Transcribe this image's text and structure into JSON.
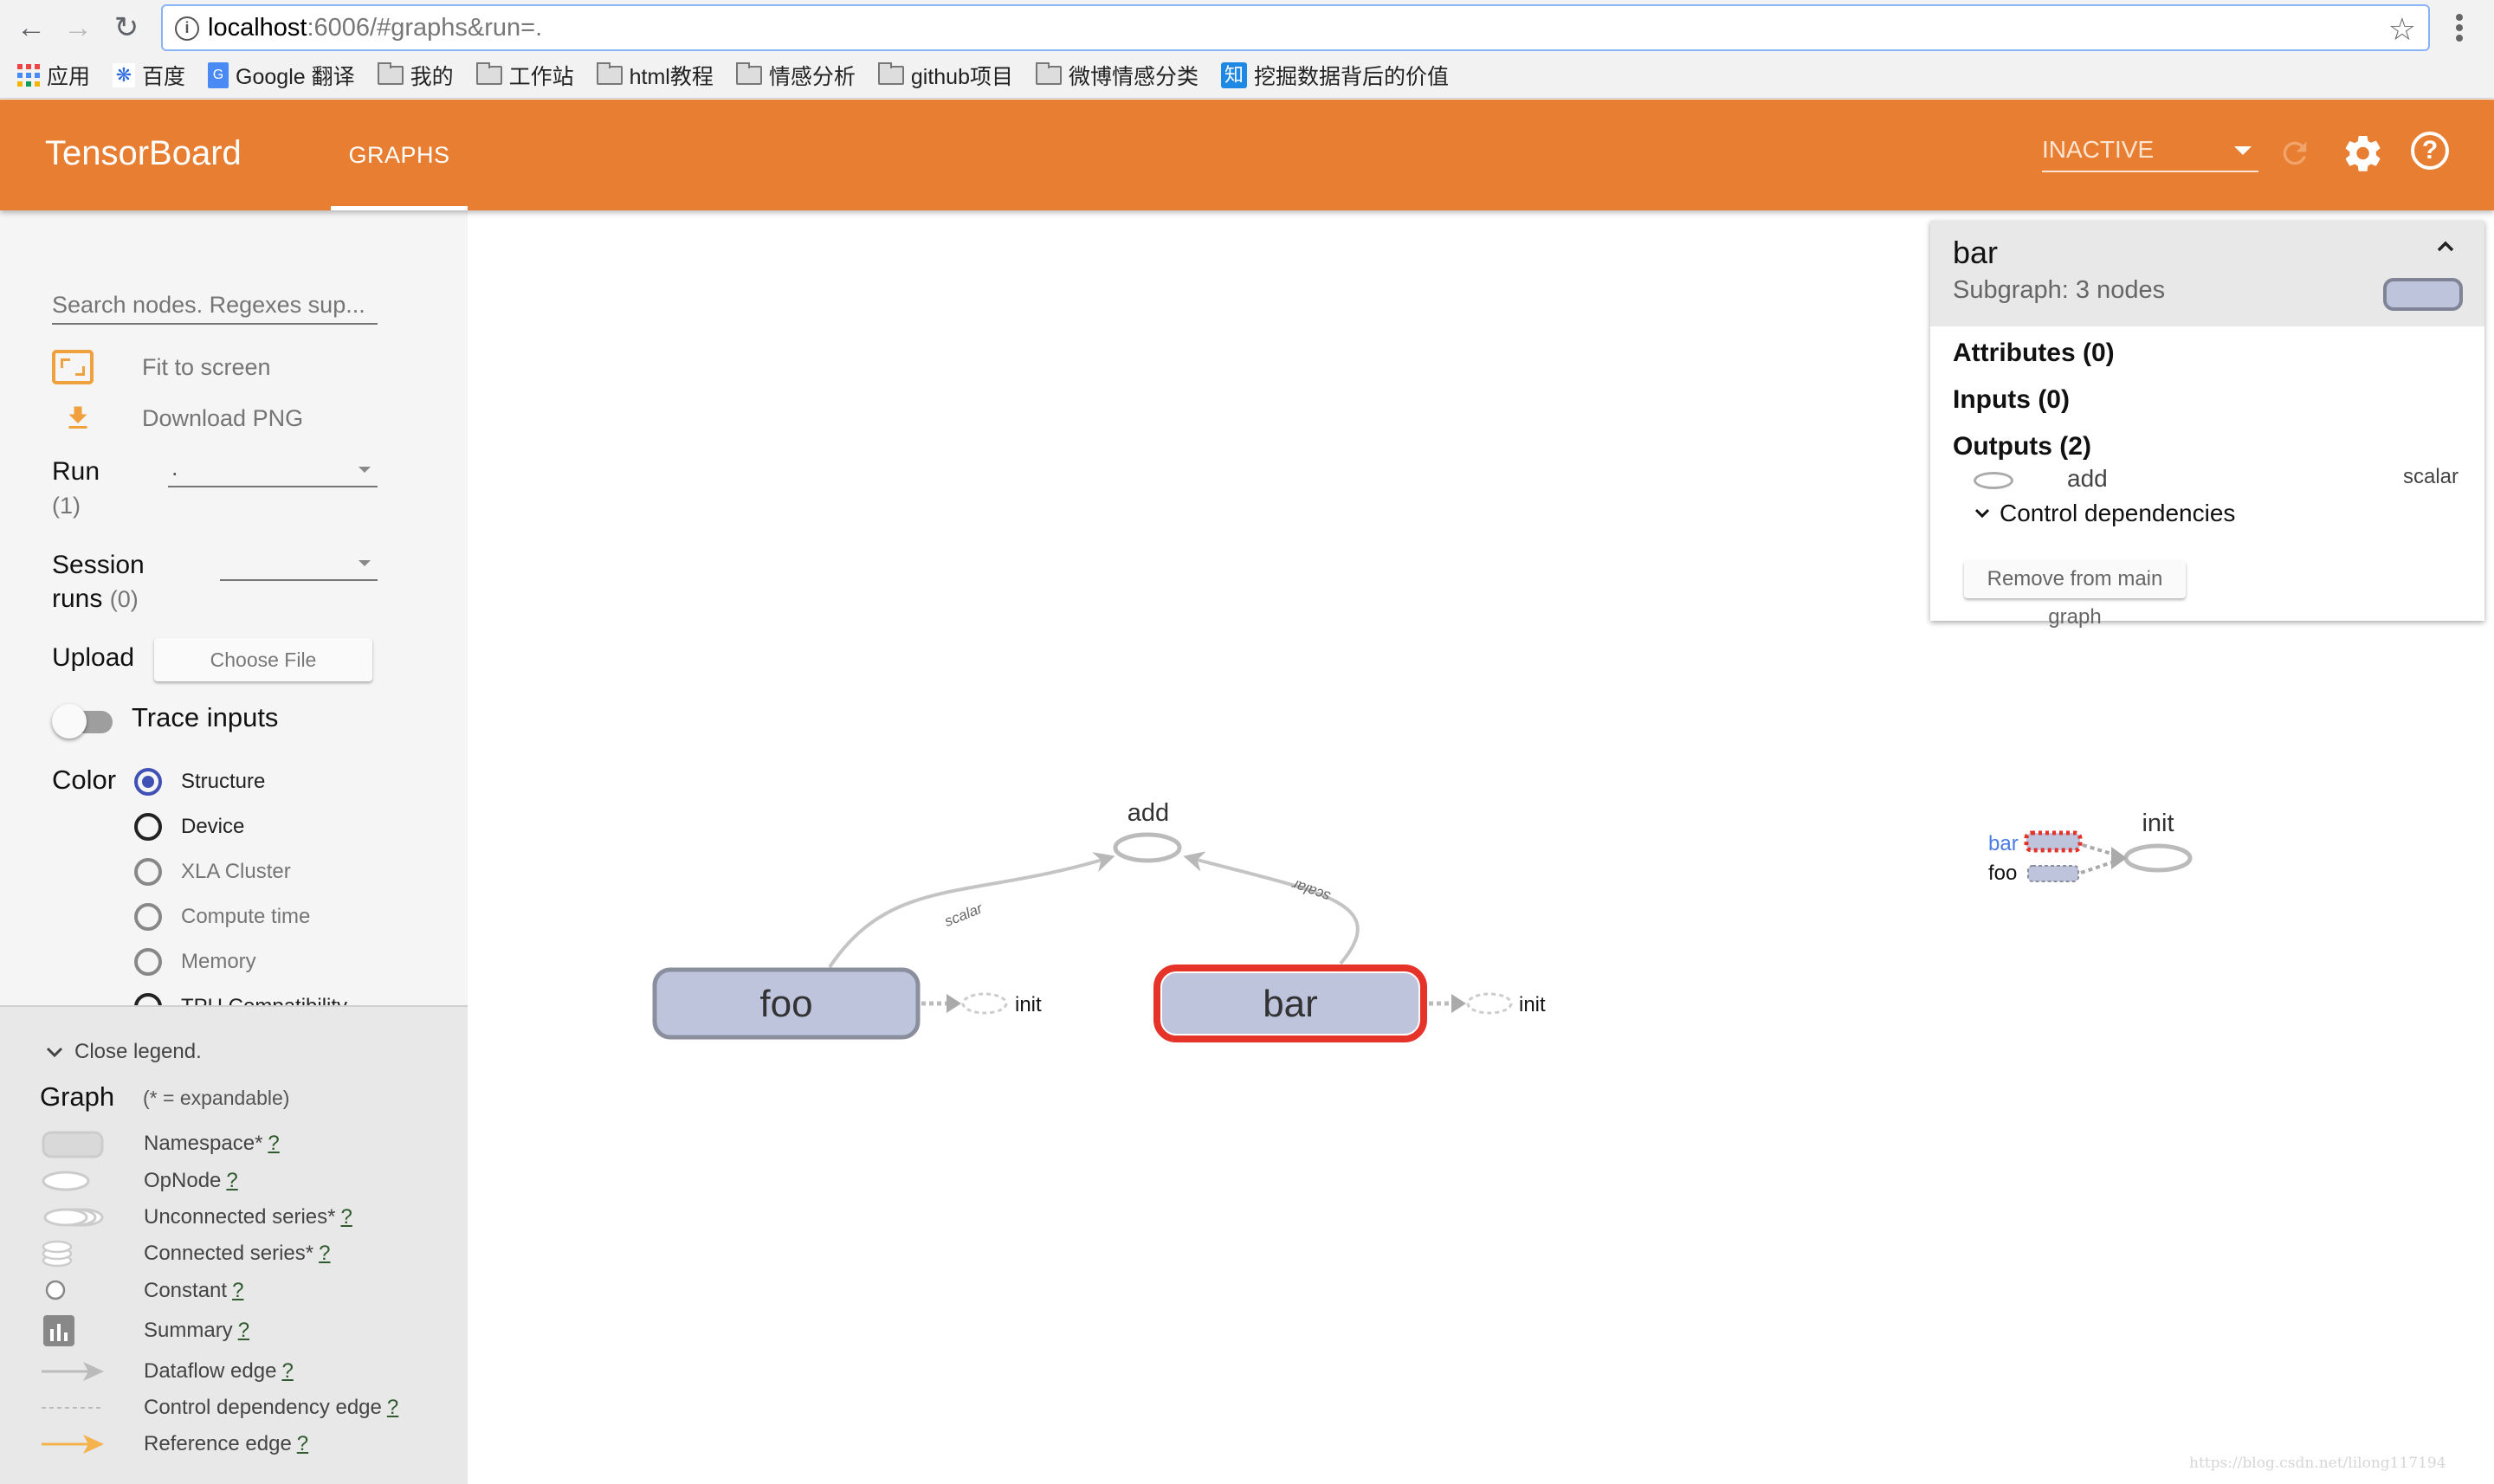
{
  "browser": {
    "url_host": "localhost",
    "url_rest": ":6006/#graphs&run=.",
    "bookmarks": [
      {
        "label": "应用",
        "icon": "apps-grid-icon"
      },
      {
        "label": "百度",
        "icon": "baidu-icon"
      },
      {
        "label": "Google 翻译",
        "icon": "google-translate-icon"
      },
      {
        "label": "我的",
        "icon": "folder-icon"
      },
      {
        "label": "工作站",
        "icon": "folder-icon"
      },
      {
        "label": "html教程",
        "icon": "folder-icon"
      },
      {
        "label": "情感分析",
        "icon": "folder-icon"
      },
      {
        "label": "github项目",
        "icon": "folder-icon"
      },
      {
        "label": "微博情感分类",
        "icon": "folder-icon"
      },
      {
        "label": "挖掘数据背后的价值",
        "icon": "zhihu-icon"
      }
    ]
  },
  "header": {
    "brand": "TensorBoard",
    "tab": "GRAPHS",
    "run_select": "INACTIVE",
    "accent_color": "#e87e31"
  },
  "sidebar": {
    "search_placeholder": "Search nodes. Regexes sup...",
    "fit_label": "Fit to screen",
    "download_label": "Download PNG",
    "run_label": "Run",
    "run_count": "(1)",
    "run_value": ".",
    "session_label_1": "Session",
    "session_label_2": "runs",
    "session_count": "(0)",
    "session_value": "",
    "upload_label": "Upload",
    "choose_file": "Choose File",
    "trace_inputs": "Trace inputs",
    "trace_inputs_on": false,
    "color_label": "Color",
    "color_options": [
      {
        "label": "Structure",
        "selected": true
      },
      {
        "label": "Device",
        "selected": false
      },
      {
        "label": "XLA Cluster",
        "selected": false
      },
      {
        "label": "Compute time",
        "selected": false
      },
      {
        "label": "Memory",
        "selected": false
      },
      {
        "label": "TPU Compatibility",
        "selected": false
      }
    ]
  },
  "legend": {
    "close": "Close legend.",
    "title": "Graph",
    "subtitle": "(* = expandable)",
    "help": "?",
    "items": [
      {
        "label": "Namespace*"
      },
      {
        "label": "OpNode"
      },
      {
        "label": "Unconnected series*"
      },
      {
        "label": "Connected series*"
      },
      {
        "label": "Constant"
      },
      {
        "label": "Summary"
      },
      {
        "label": "Dataflow edge"
      },
      {
        "label": "Control dependency edge"
      },
      {
        "label": "Reference edge"
      }
    ]
  },
  "graph": {
    "nodes": {
      "add": "add",
      "foo": "foo",
      "bar": "bar",
      "init_foo": "init",
      "init_bar": "init"
    },
    "edge_labels": {
      "foo_add": "scalar",
      "bar_add": "scalar"
    },
    "aux": {
      "init": "init",
      "bar": "bar",
      "foo": "foo"
    },
    "selected_color": "#e6332a",
    "namespace_fill": "#bdc4dc"
  },
  "info": {
    "title": "bar",
    "subtitle": "Subgraph: 3 nodes",
    "attributes": "Attributes (0)",
    "inputs": "Inputs (0)",
    "outputs": "Outputs (2)",
    "output_name": "add",
    "output_type": "scalar",
    "control_deps": "Control dependencies",
    "remove": "Remove from main graph"
  },
  "watermark": "https://blog.csdn.net/lilong117194"
}
